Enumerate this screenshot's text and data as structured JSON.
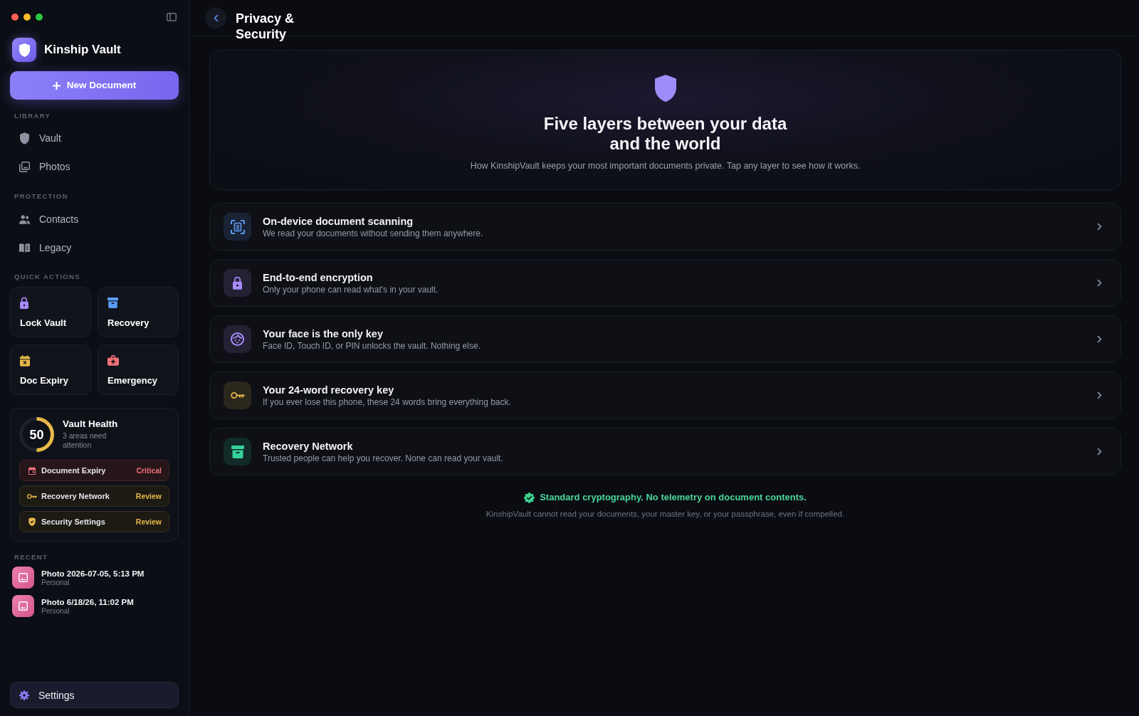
{
  "sidebar": {
    "app_name": "Kinship Vault",
    "new_document_button": "New Document",
    "sections": [
      {
        "title": "LIBRARY",
        "items": [
          {
            "label": "Vault",
            "selected": false
          },
          {
            "label": "Photos",
            "selected": false
          }
        ]
      },
      {
        "title": "PROTECTION",
        "items": [
          {
            "label": "Contacts",
            "selected": false
          },
          {
            "label": "Legacy",
            "selected": false
          }
        ]
      }
    ],
    "quick_actions": {
      "title": "QUICK ACTIONS",
      "items": [
        {
          "label": "Lock Vault",
          "color": "#a78bfa"
        },
        {
          "label": "Recovery",
          "color": "#5b9cf6"
        },
        {
          "label": "Doc Expiry",
          "color": "#e6b84a"
        },
        {
          "label": "Emergency",
          "color": "#f07178"
        }
      ]
    },
    "vault_health": {
      "score": "50",
      "level": 0.5,
      "title": "Vault Health",
      "subtitle": "3 areas need attention",
      "items": [
        {
          "label": "Document Expiry",
          "status": "Critical",
          "kind": "critical"
        },
        {
          "label": "Recovery Network",
          "status": "Review",
          "kind": "review"
        },
        {
          "label": "Security Settings",
          "status": "Review",
          "kind": "review"
        }
      ]
    },
    "recent": {
      "title": "RECENT",
      "items": [
        {
          "title": "Photo 2026-07-05, 5:13 PM",
          "subtitle": "Personal"
        },
        {
          "title": "Photo 6/18/26, 11:02 PM",
          "subtitle": "Personal"
        }
      ]
    },
    "settings": {
      "label": "Settings",
      "selected": true
    }
  },
  "header": {
    "title": "Privacy & Security"
  },
  "hero": {
    "heading": "Five layers between your data and the world",
    "subtitle": "How KinshipVault keeps your most important documents private. Tap any layer to see how it works."
  },
  "layers": [
    {
      "title": "On-device document scanning",
      "description": "We read your documents without sending them anywhere.",
      "color": "#5b9cf6"
    },
    {
      "title": "End-to-end encryption",
      "description": "Only your phone can read what's in your vault.",
      "color": "#a78bfa"
    },
    {
      "title": "Your face is the only key",
      "description": "Face ID, Touch ID, or PIN unlocks the vault. Nothing else.",
      "color": "#a78bfa"
    },
    {
      "title": "Your 24-word recovery key",
      "description": "If you ever lose this phone, these 24 words bring everything back.",
      "color": "#e6b84a"
    },
    {
      "title": "Recovery Network",
      "description": "Trusted people can help you recover. None can read your vault.",
      "color": "#34d399"
    }
  ],
  "footer": {
    "badge": "Standard cryptography. No telemetry on document contents.",
    "note": "KinshipVault cannot read your documents, your master key, or your passphrase, even if compelled."
  }
}
